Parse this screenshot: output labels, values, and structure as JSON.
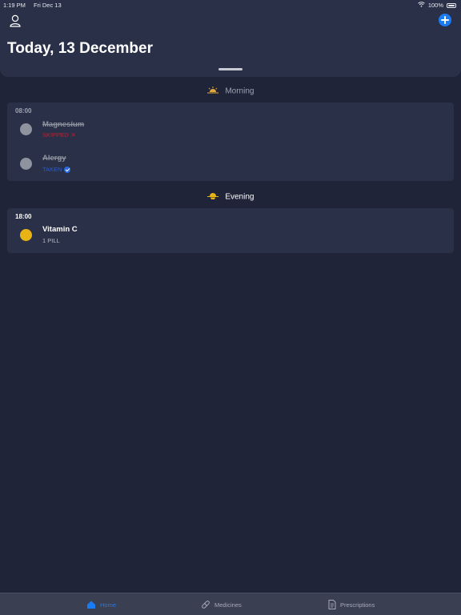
{
  "status_bar": {
    "time": "1:19 PM",
    "date": "Fri Dec 13",
    "battery": "100%"
  },
  "header": {
    "title": "Today, 13 December",
    "profile_icon": "person-icon",
    "add_icon": "plus-icon"
  },
  "sections": {
    "morning": {
      "label": "Morning",
      "icon": "sunrise-icon",
      "time": "08:00",
      "items": [
        {
          "name": "Magnesium",
          "status": "SKIPPED",
          "status_mark": "✕",
          "pill_color": "#8f939e"
        },
        {
          "name": "Alergy",
          "status": "TAKEN",
          "pill_color": "#8f939e"
        }
      ]
    },
    "evening": {
      "label": "Evening",
      "icon": "sunset-icon",
      "time": "18:00",
      "items": [
        {
          "name": "Vitamin C",
          "status": "1 PILL",
          "pill_color": "#e8b415"
        }
      ]
    }
  },
  "tab_bar": {
    "tabs": [
      {
        "label": "Home",
        "icon": "home-icon",
        "active": true
      },
      {
        "label": "Medicines",
        "icon": "pill-icon",
        "active": false
      },
      {
        "label": "Prescriptions",
        "icon": "document-icon",
        "active": false
      }
    ]
  },
  "colors": {
    "background": "#1f2438",
    "surface": "#2a3047",
    "accent": "#1a7cf5",
    "skipped": "#c02030",
    "taken": "#2b5bd0",
    "pill_yellow": "#e8b415"
  }
}
